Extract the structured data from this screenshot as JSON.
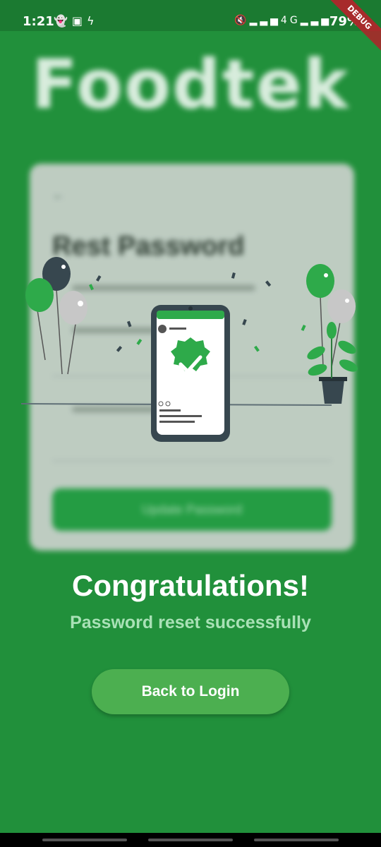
{
  "status_bar": {
    "time": "1:21",
    "left_icons": [
      "snapchat-icon",
      "image-icon",
      "flash-icon"
    ],
    "right_icons": [
      "mute-icon",
      "signal-icon",
      "4g-icon",
      "signal-icon"
    ],
    "battery": "79%",
    "debug_label": "DEBUG"
  },
  "background_page": {
    "brand": "Foodtek",
    "card_title": "Rest Password",
    "button_label": "Update Password"
  },
  "success": {
    "title": "Congratulations!",
    "subtitle": "Password reset successfully",
    "back_button": "Back to Login"
  },
  "colors": {
    "background": "#22913c",
    "button": "#4caf50",
    "subtitle": "#a9e1b6"
  }
}
